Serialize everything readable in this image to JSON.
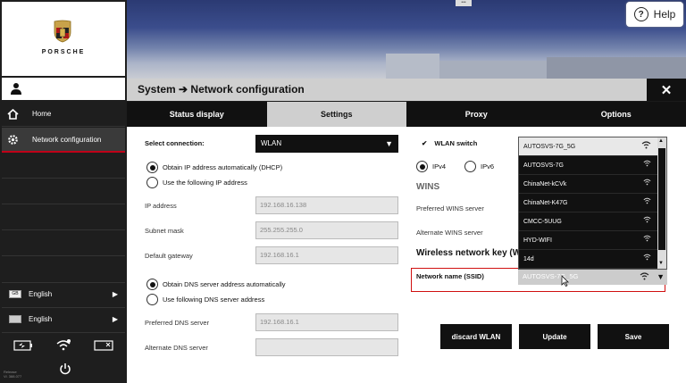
{
  "brand": {
    "logo_text": "PORSCHE"
  },
  "header": {
    "title": "System ➔ Network configuration",
    "help_label": "Help",
    "top_dots": "•••",
    "close_symbol": "✕"
  },
  "sidebar": {
    "items": [
      {
        "label": "Home",
        "icon": "home-icon"
      },
      {
        "label": "Network configuration",
        "icon": "gear-icon"
      }
    ],
    "languages": [
      {
        "label": "English",
        "icon": "gb-flag-icon"
      },
      {
        "label": "English",
        "icon": "keyboard-icon"
      }
    ],
    "version_text": "Release\nVl. 388.077"
  },
  "tabs": [
    {
      "label": "Status display",
      "active": false
    },
    {
      "label": "Settings",
      "active": true
    },
    {
      "label": "Proxy",
      "active": false
    },
    {
      "label": "Options",
      "active": false
    }
  ],
  "form": {
    "connection_label": "Select connection:",
    "connection_value": "WLAN",
    "ip_auto_label": "Obtain IP address automatically (DHCP)",
    "ip_manual_label": "Use the following IP address",
    "ip_label": "IP address",
    "ip_value": "192.168.16.138",
    "subnet_label": "Subnet mask",
    "subnet_value": "255.255.255.0",
    "gateway_label": "Default gateway",
    "gateway_value": "192.168.16.1",
    "dns_auto_label": "Obtain DNS server address automatically",
    "dns_manual_label": "Use following DNS server address",
    "pref_dns_label": "Preferred DNS server",
    "pref_dns_value": "192.168.16.1",
    "alt_dns_label": "Alternate DNS server",
    "alt_dns_value": "",
    "wlan_switch_label": "WLAN switch",
    "ipv4_label": "IPv4",
    "ipv6_label": "IPv6",
    "wins_label": "WINS",
    "pref_wins_label": "Preferred WINS server",
    "alt_wins_label": "Alternate WINS server",
    "wireless_key_label": "Wireless network key (W",
    "ssid_label": "Network name (SSID)",
    "ssid_value": "AUTOSVS-7G_5G"
  },
  "ssid_options": [
    "AUTOSVS-7G_5G",
    "AUTOSVS-7G",
    "ChinaNet-kCVk",
    "ChinaNet-K47G",
    "CMCC-5UUG",
    "HYD-WIFI",
    "14d"
  ],
  "buttons": {
    "discard": "discard WLAN",
    "update": "Update",
    "save": "Save"
  },
  "colors": {
    "accent": "#c00018",
    "dark": "#111111",
    "panel": "#cfcfcf"
  }
}
